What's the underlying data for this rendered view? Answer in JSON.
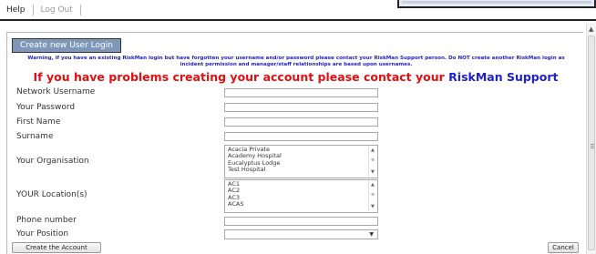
{
  "menu": {
    "help": "Help",
    "logout": "Log Out"
  },
  "tab": {
    "label": "Create new User Login"
  },
  "warning": "Warning, if you have an existing RiskMan login but have forgotten your username and/or password please contact your RiskMan Support person. Do NOT create another RiskMan login as incident permission and manager/staff relationships are based upon usernames.",
  "problems": {
    "main": "If you have problems creating your account please contact your ",
    "support": "RiskMan Support person",
    "end": "."
  },
  "fields": {
    "network_username": "Network Username",
    "password": "Your Password",
    "first_name": "First Name",
    "surname": "Surname",
    "organisation": "Your Organisation",
    "locations": "YOUR Location(s)",
    "phone": "Phone number",
    "position": "Your Position"
  },
  "organisation_options": [
    "Acacia Private",
    "Academy Hospital",
    "Eucalyptus Lodge",
    "Test Hospital"
  ],
  "location_options": [
    "AC1",
    "AC2",
    "AC3",
    "ACAS"
  ],
  "buttons": {
    "create": "Create the Account",
    "cancel": "Cancel"
  },
  "colors": {
    "tab_bg": "#7f97b8",
    "warning_text": "#2222cc",
    "problems_text": "#e01010",
    "support_text": "#2020c8"
  },
  "icons": {
    "scroll_up": "up-arrow-icon",
    "dropdown": "chevron-down-icon"
  }
}
